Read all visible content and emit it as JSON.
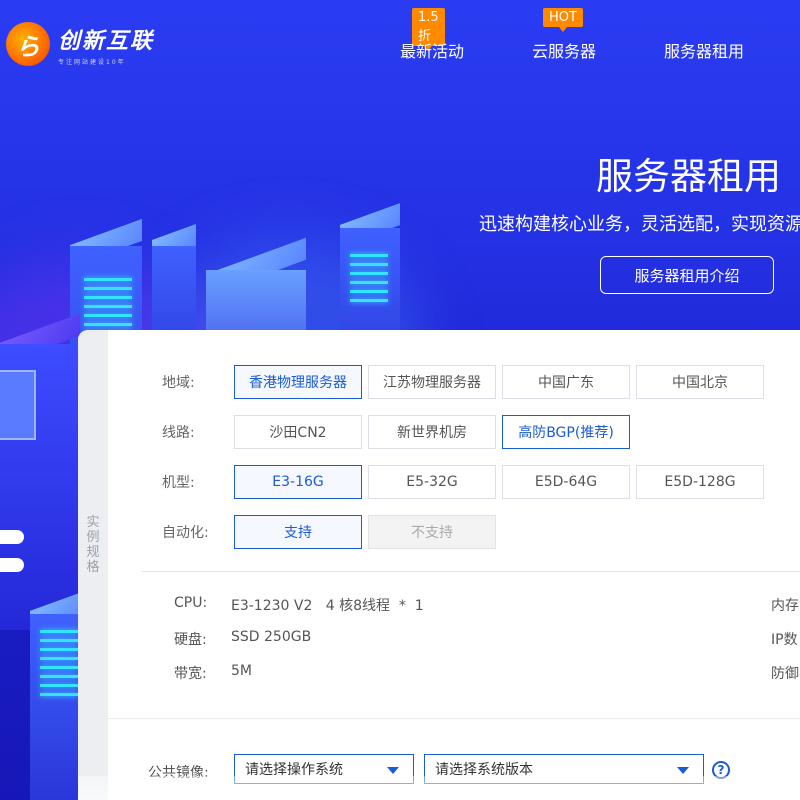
{
  "brand": {
    "logo_glyph": "ら",
    "name": "创新互联",
    "slogan": "专注网站建设10年"
  },
  "nav": {
    "items": [
      {
        "label": "最新活动",
        "badge": "1.5折"
      },
      {
        "label": "云服务器",
        "badge": "HOT"
      },
      {
        "label": "服务器租用",
        "badge": ""
      }
    ]
  },
  "hero": {
    "title": "服务器租用",
    "subtitle": "迅速构建核心业务，灵活选配，实现资源",
    "button": "服务器租用介绍"
  },
  "panel": {
    "side_label": "实例规格",
    "region": {
      "label": "地域:",
      "options": [
        "香港物理服务器",
        "江苏物理服务器",
        "中国广东",
        "中国北京"
      ],
      "selected": 0
    },
    "line": {
      "label": "线路:",
      "options": [
        "沙田CN2",
        "新世界机房",
        "高防BGP(推荐)"
      ],
      "selected": 0
    },
    "model": {
      "label": "机型:",
      "options": [
        "E3-16G",
        "E5-32G",
        "E5D-64G",
        "E5D-128G"
      ],
      "selected": 0
    },
    "automation": {
      "label": "自动化:",
      "options": [
        "支持",
        "不支持"
      ],
      "selected": 0
    },
    "specs": {
      "cpu_k": "CPU:",
      "cpu_v": "E3-1230 V2   4 核8线程  *  1",
      "disk_k": "硬盘:",
      "disk_v": "SSD 250GB",
      "bw_k": "带宽:",
      "bw_v": "5M",
      "mem_k": "内存",
      "ip_k": "IP数",
      "def_k": "防御"
    },
    "image": {
      "label": "公共镜像:",
      "os_placeholder": "请选择操作系统",
      "version_placeholder": "请选择系统版本",
      "help": "?"
    }
  },
  "colors": {
    "accent": "#1a5bd6",
    "badge": "#ff8a00",
    "hero_bg": "#2431e4"
  }
}
